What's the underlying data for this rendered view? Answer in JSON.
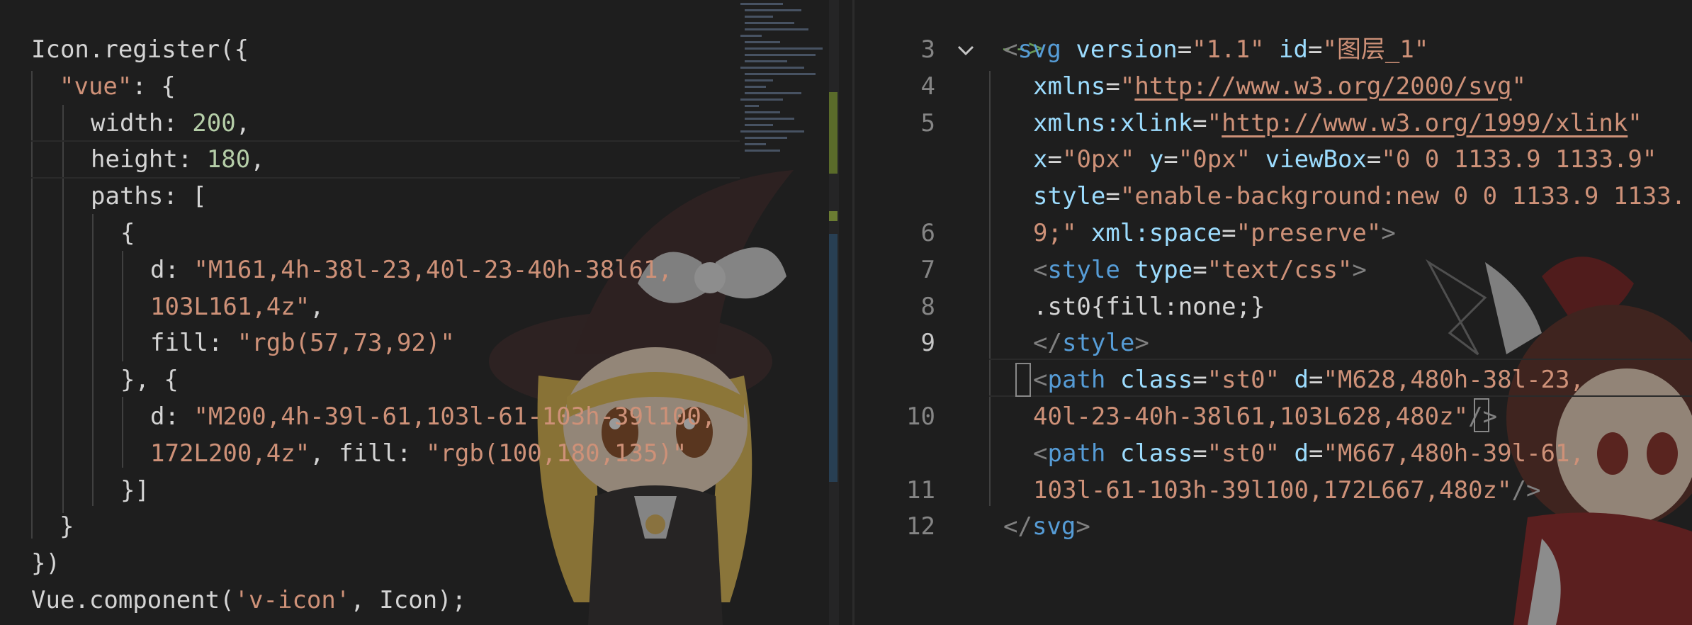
{
  "left_editor": {
    "lines": [
      [
        [
          "tok-plain",
          "Icon.register({"
        ]
      ],
      [
        [
          "tok-str",
          "\"vue\""
        ],
        [
          "tok-plain",
          ": {"
        ]
      ],
      [
        [
          "tok-plain",
          "width: "
        ],
        [
          "tok-num",
          "200"
        ],
        [
          "tok-plain",
          ","
        ]
      ],
      [
        [
          "tok-plain",
          "height: "
        ],
        [
          "tok-num",
          "180"
        ],
        [
          "tok-plain",
          ","
        ]
      ],
      [
        [
          "tok-plain",
          "paths: ["
        ]
      ],
      [
        [
          "tok-plain",
          "{"
        ]
      ],
      [
        [
          "tok-plain",
          "d: "
        ],
        [
          "tok-str",
          "\"M161,4h-38l-23,40l-23-40h-38l61,"
        ]
      ],
      [
        [
          "tok-str",
          "103L161,4z\""
        ],
        [
          "tok-plain",
          ","
        ]
      ],
      [
        [
          "tok-plain",
          "fill: "
        ],
        [
          "tok-str",
          "\"rgb(57,73,92)\""
        ]
      ],
      [
        [
          "tok-plain",
          "}, {"
        ]
      ],
      [
        [
          "tok-plain",
          "d: "
        ],
        [
          "tok-str",
          "\"M200,4h-39l-61,103l-61-103h-39l100,"
        ]
      ],
      [
        [
          "tok-str",
          "172L200,4z\""
        ],
        [
          "tok-plain",
          ", fill: "
        ],
        [
          "tok-str",
          "\"rgb(100,180,135)\""
        ]
      ],
      [
        [
          "tok-plain",
          "}]"
        ]
      ],
      [
        [
          "tok-plain",
          "}"
        ]
      ],
      [
        [
          "tok-plain",
          "})"
        ]
      ],
      [
        [
          "tok-plain",
          "Vue.component("
        ],
        [
          "tok-str",
          "'v-icon'"
        ],
        [
          "tok-plain",
          ", Icon);"
        ]
      ]
    ]
  },
  "right_editor": {
    "top_fragment": "-->",
    "line_numbers": [
      "3",
      "4",
      "5",
      "",
      "",
      "6",
      "7",
      "8",
      "9",
      "",
      "10",
      "",
      "11",
      "12"
    ],
    "active_line": "9",
    "lines": [
      [
        [
          "tok-tagp",
          "<"
        ],
        [
          "tok-tag",
          "svg"
        ],
        [
          "tok-plain",
          " "
        ],
        [
          "tok-key",
          "version"
        ],
        [
          "tok-plain",
          "="
        ],
        [
          "tok-str",
          "\"1.1\""
        ],
        [
          "tok-plain",
          " "
        ],
        [
          "tok-key",
          "id"
        ],
        [
          "tok-plain",
          "="
        ],
        [
          "tok-str",
          "\"图层_1\""
        ]
      ],
      [
        [
          "tok-key",
          "xmlns"
        ],
        [
          "tok-plain",
          "="
        ],
        [
          "tok-str",
          "\""
        ],
        [
          "tok-link",
          "http://www.w3.org/2000/svg"
        ],
        [
          "tok-str",
          "\""
        ]
      ],
      [
        [
          "tok-key",
          "xmlns:xlink"
        ],
        [
          "tok-plain",
          "="
        ],
        [
          "tok-str",
          "\""
        ],
        [
          "tok-link",
          "http://www.w3.org/1999/xlink"
        ],
        [
          "tok-str",
          "\""
        ]
      ],
      [
        [
          "tok-key",
          "x"
        ],
        [
          "tok-plain",
          "="
        ],
        [
          "tok-str",
          "\"0px\""
        ],
        [
          "tok-plain",
          " "
        ],
        [
          "tok-key",
          "y"
        ],
        [
          "tok-plain",
          "="
        ],
        [
          "tok-str",
          "\"0px\""
        ],
        [
          "tok-plain",
          " "
        ],
        [
          "tok-key",
          "viewBox"
        ],
        [
          "tok-plain",
          "="
        ],
        [
          "tok-str",
          "\"0 0 1133.9 1133.9\""
        ]
      ],
      [
        [
          "tok-key",
          "style"
        ],
        [
          "tok-plain",
          "="
        ],
        [
          "tok-str",
          "\"enable-background:new 0 0 1133.9 1133."
        ]
      ],
      [
        [
          "tok-str",
          "9;\""
        ],
        [
          "tok-plain",
          " "
        ],
        [
          "tok-key",
          "xml:space"
        ],
        [
          "tok-plain",
          "="
        ],
        [
          "tok-str",
          "\"preserve\""
        ],
        [
          "tok-tagp",
          ">"
        ]
      ],
      [
        [
          "tok-tagp",
          "<"
        ],
        [
          "tok-tag",
          "style"
        ],
        [
          "tok-plain",
          " "
        ],
        [
          "tok-key",
          "type"
        ],
        [
          "tok-plain",
          "="
        ],
        [
          "tok-str",
          "\"text/css\""
        ],
        [
          "tok-tagp",
          ">"
        ]
      ],
      [
        [
          "tok-plain",
          ".st0{fill:none;}"
        ]
      ],
      [
        [
          "tok-tagp",
          "</"
        ],
        [
          "tok-tag",
          "style"
        ],
        [
          "tok-tagp",
          ">"
        ]
      ],
      [
        [
          "tok-tagp",
          "<"
        ],
        [
          "tok-tag",
          "path"
        ],
        [
          "tok-plain",
          " "
        ],
        [
          "tok-key",
          "class"
        ],
        [
          "tok-plain",
          "="
        ],
        [
          "tok-str",
          "\"st0\""
        ],
        [
          "tok-plain",
          " "
        ],
        [
          "tok-key",
          "d"
        ],
        [
          "tok-plain",
          "="
        ],
        [
          "tok-str",
          "\"M628,480h-38l-23,"
        ]
      ],
      [
        [
          "tok-str",
          "40l-23-40h-38l61,103L628,480z\""
        ],
        [
          "tok-tagp",
          "/>"
        ]
      ],
      [
        [
          "tok-tagp",
          "<"
        ],
        [
          "tok-tag",
          "path"
        ],
        [
          "tok-plain",
          " "
        ],
        [
          "tok-key",
          "class"
        ],
        [
          "tok-plain",
          "="
        ],
        [
          "tok-str",
          "\"st0\""
        ],
        [
          "tok-plain",
          " "
        ],
        [
          "tok-key",
          "d"
        ],
        [
          "tok-plain",
          "="
        ],
        [
          "tok-str",
          "\"M667,480h-39l-61,"
        ]
      ],
      [
        [
          "tok-str",
          "103l-61-103h-39l100,172L667,480z\""
        ],
        [
          "tok-tagp",
          "/>"
        ]
      ],
      [
        [
          "tok-tagp",
          "</"
        ],
        [
          "tok-tag",
          "svg"
        ],
        [
          "tok-tagp",
          ">"
        ]
      ],
      []
    ]
  },
  "colors": {
    "background": "#1e1e1e",
    "string": "#ce9178",
    "number": "#b5cea8",
    "attribute": "#9cdcfe",
    "tag": "#569cd6",
    "comment": "#6a9955"
  },
  "icons": [
    "fold-chevron-icon",
    "minimap",
    "character-art-marisa",
    "character-art-reimu"
  ]
}
